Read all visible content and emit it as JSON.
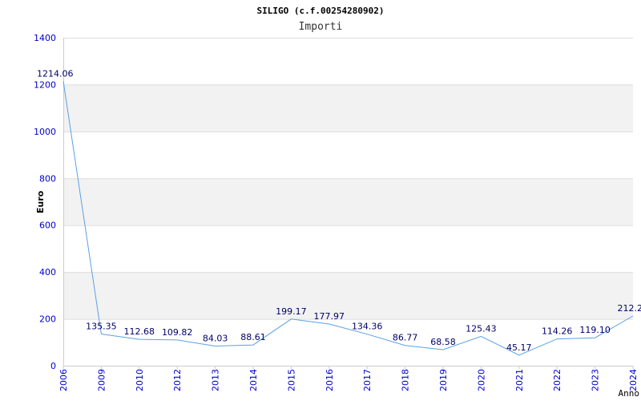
{
  "chart_data": {
    "type": "line",
    "title": "SILIGO (c.f.00254280902)",
    "subtitle": "Importi",
    "ylabel": "Euro",
    "xlabel": "Anno",
    "ylim": [
      0,
      1400
    ],
    "yticks": [
      0,
      200,
      400,
      600,
      800,
      1000,
      1200,
      1400
    ],
    "grid": true,
    "band_color": "#f2f2f2",
    "line_color": "#5aa0e6",
    "tick_color": "#0000cc",
    "categories": [
      "2006",
      "2009",
      "2010",
      "2012",
      "2013",
      "2014",
      "2015",
      "2016",
      "2017",
      "2018",
      "2019",
      "2020",
      "2021",
      "2022",
      "2023",
      "2024"
    ],
    "values": [
      1214.06,
      135.35,
      112.68,
      109.82,
      84.03,
      88.61,
      199.17,
      177.97,
      134.36,
      86.77,
      68.58,
      125.43,
      45.17,
      114.26,
      119.1,
      212.2
    ],
    "value_labels": [
      "1214.06",
      "135.35",
      "112.68",
      "109.82",
      "84.03",
      "88.61",
      "199.17",
      "177.97",
      "134.36",
      "86.77",
      "68.58",
      "125.43",
      "45.17",
      "114.26",
      "119.10",
      "212.2"
    ]
  }
}
